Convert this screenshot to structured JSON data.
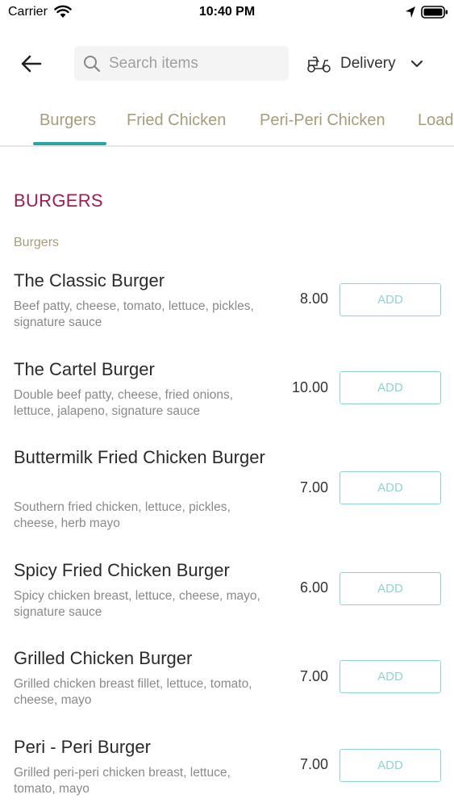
{
  "status_bar": {
    "carrier": "Carrier",
    "time": "10:40 PM"
  },
  "header": {
    "search_placeholder": "Search items",
    "delivery_label": "Delivery"
  },
  "tabs": [
    {
      "label": "Burgers",
      "active": true
    },
    {
      "label": "Fried Chicken",
      "active": false
    },
    {
      "label": "Peri-Peri Chicken",
      "active": false
    },
    {
      "label": "Load",
      "active": false
    }
  ],
  "colors": {
    "accent": "#2aa6a2",
    "section_title": "#a31c48",
    "tab_text": "#a69d7c",
    "add_button": "#8fd4d2"
  },
  "section": {
    "title": "BURGERS",
    "subtitle": "Burgers"
  },
  "items": [
    {
      "name": "The Classic Burger",
      "description": "Beef patty, cheese, tomato, lettuce, pickles, signature sauce",
      "price": "8.00",
      "add_label": "ADD"
    },
    {
      "name": "The Cartel Burger",
      "description": "Double beef patty, cheese, fried onions, lettuce, jalapeno, signature sauce",
      "price": "10.00",
      "add_label": "ADD"
    },
    {
      "name": "Buttermilk Fried Chicken Burger",
      "description": "Southern fried chicken, lettuce, pickles, cheese, herb mayo",
      "price": "7.00",
      "add_label": "ADD"
    },
    {
      "name": "Spicy Fried Chicken Burger",
      "description": "Spicy chicken breast, lettuce, cheese, mayo, signature sauce",
      "price": "6.00",
      "add_label": "ADD"
    },
    {
      "name": "Grilled Chicken Burger",
      "description": "Grilled chicken breast fillet, lettuce, tomato, cheese, mayo",
      "price": "7.00",
      "add_label": "ADD"
    },
    {
      "name": "Peri - Peri Burger",
      "description": "Grilled peri-peri chicken breast, lettuce, tomato, mayo",
      "price": "7.00",
      "add_label": "ADD"
    }
  ]
}
